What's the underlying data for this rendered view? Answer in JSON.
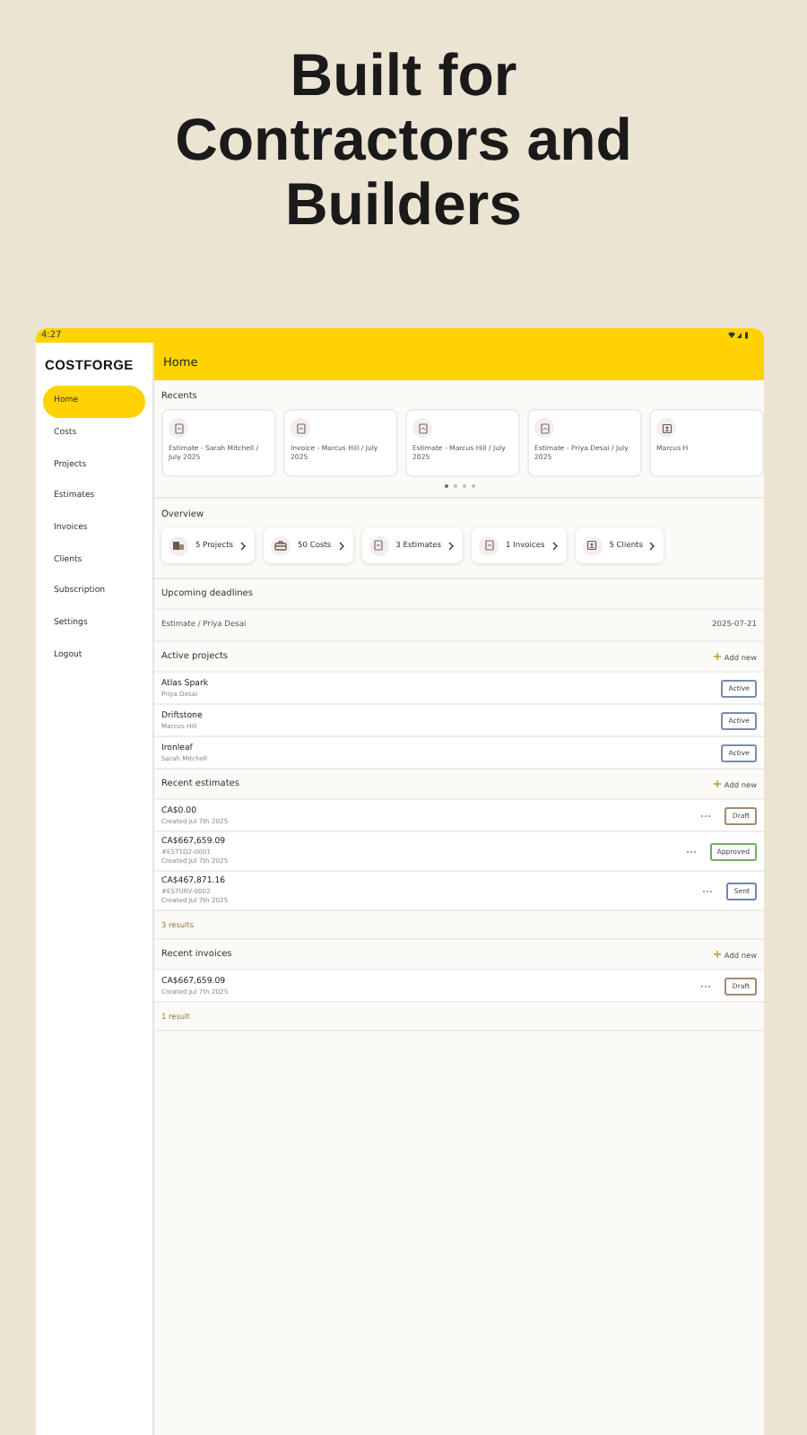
{
  "headline": [
    "Built for",
    "Contractors and",
    "Builders"
  ],
  "status_bar": {
    "time": "4:27"
  },
  "sidebar": {
    "logo": "COSTFORGE",
    "items": [
      {
        "label": "Home",
        "selected": true
      },
      {
        "label": "Costs",
        "selected": false
      },
      {
        "label": "Projects",
        "selected": false
      },
      {
        "label": "Estimates",
        "selected": false
      },
      {
        "label": "Invoices",
        "selected": false
      },
      {
        "label": "Clients",
        "selected": false
      },
      {
        "label": "Subscription",
        "selected": false
      },
      {
        "label": "Settings",
        "selected": false
      },
      {
        "label": "Logout",
        "selected": false
      }
    ]
  },
  "header": {
    "title": "Home"
  },
  "recents": {
    "title": "Recents",
    "cards": [
      {
        "label": "Estimate - Sarah Mitchell / July 2025",
        "kind": "document"
      },
      {
        "label": "Invoice - Marcus Hill / July 2025",
        "kind": "document"
      },
      {
        "label": "Estimate - Marcus Hill / July 2025",
        "kind": "document"
      },
      {
        "label": "Estimate - Priya Desai / July 2025",
        "kind": "document"
      },
      {
        "label": "Marcus H",
        "kind": "contact"
      }
    ],
    "pages": [
      {
        "selected": true
      },
      {
        "selected": false
      },
      {
        "selected": false
      },
      {
        "selected": false
      }
    ]
  },
  "overview": {
    "title": "Overview",
    "chips": [
      {
        "label": "5 Projects",
        "kind": "building"
      },
      {
        "label": "50 Costs",
        "kind": "toolbox"
      },
      {
        "label": "3 Estimates",
        "kind": "document"
      },
      {
        "label": "1 Invoices",
        "kind": "document"
      },
      {
        "label": "5 Clients",
        "kind": "contact"
      }
    ]
  },
  "deadlines": {
    "title": "Upcoming deadlines",
    "rows": [
      {
        "label": "Estimate / Priya Desai",
        "date": "2025-07-21"
      }
    ]
  },
  "active_projects": {
    "title": "Active projects",
    "add": "Add new",
    "rows": [
      {
        "name": "Atlas Spark",
        "client": "Priya Desai",
        "status": "Active",
        "color": "#7a8cae"
      },
      {
        "name": "Driftstone",
        "client": "Marcus Hill",
        "status": "Active",
        "color": "#7a8cae"
      },
      {
        "name": "Ironleaf",
        "client": "Sarah Mitchell",
        "status": "Active",
        "color": "#7a8cae"
      }
    ]
  },
  "recent_estimates": {
    "title": "Recent estimates",
    "add": "Add new",
    "rows": [
      {
        "amount": "CA$0.00",
        "lines": [
          "Created Jul 7th 2025"
        ],
        "status": "Draft",
        "color": "#a08b72"
      },
      {
        "amount": "CA$667,659.09",
        "lines": [
          "#EST1D2-0001",
          "Created Jul 7th 2025"
        ],
        "status": "Approved",
        "color": "#6fae62"
      },
      {
        "amount": "CA$467,871.16",
        "lines": [
          "#ESTURV-0002",
          "Created Jul 7th 2025"
        ],
        "status": "Sent",
        "color": "#6f84b8"
      }
    ],
    "footer": "3 results"
  },
  "recent_invoices": {
    "title": "Recent invoices",
    "add": "Add new",
    "rows": [
      {
        "amount": "CA$667,659.09",
        "lines": [
          "Created Jul 7th 2025"
        ],
        "status": "Draft",
        "color": "#a08b72"
      }
    ],
    "footer": "1 result"
  }
}
